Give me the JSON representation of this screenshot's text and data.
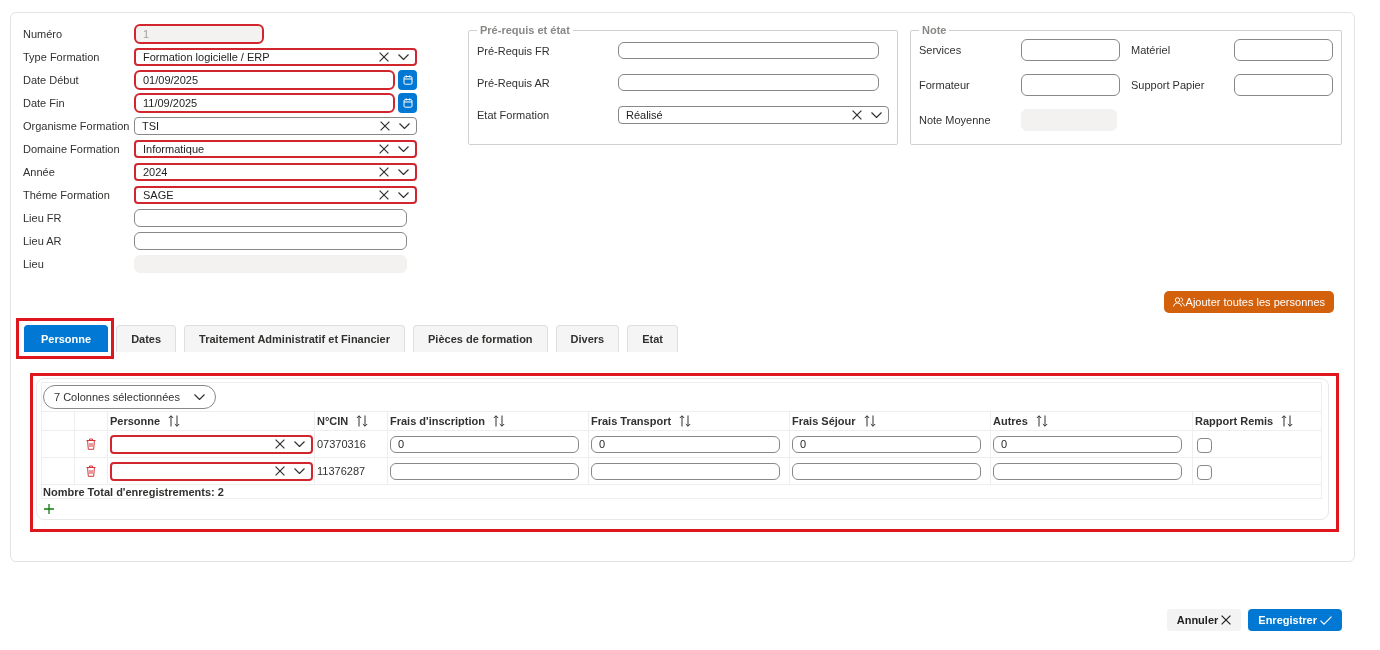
{
  "form": {
    "fields": [
      {
        "label": "Numéro",
        "kind": "number",
        "value": "1",
        "invalid": true,
        "disabled": true
      },
      {
        "label": "Type Formation",
        "kind": "select",
        "value": "Formation logicielle / ERP",
        "invalid": true,
        "disabled": false
      },
      {
        "label": "Date Début",
        "kind": "date",
        "value": "01/09/2025",
        "invalid": true,
        "disabled": false
      },
      {
        "label": "Date Fin",
        "kind": "date",
        "value": "11/09/2025",
        "invalid": true,
        "disabled": false
      },
      {
        "label": "Organisme Formation",
        "kind": "select",
        "value": "TSI",
        "invalid": false,
        "disabled": false
      },
      {
        "label": "Domaine Formation",
        "kind": "select",
        "value": "Informatique",
        "invalid": true,
        "disabled": false
      },
      {
        "label": "Année",
        "kind": "select",
        "value": "2024",
        "invalid": true,
        "disabled": false
      },
      {
        "label": "Théme Formation",
        "kind": "select",
        "value": "SAGE",
        "invalid": true,
        "disabled": false
      },
      {
        "label": "Lieu FR",
        "kind": "text",
        "invalid": false,
        "disabled": false
      },
      {
        "label": "Lieu AR",
        "kind": "text",
        "invalid": false,
        "disabled": false
      },
      {
        "label": "Lieu",
        "kind": "text",
        "invalid": false,
        "disabled": true
      }
    ]
  },
  "prerequisites": {
    "legend": "Pré-requis et état",
    "fields": [
      {
        "label": "Pré-Requis FR",
        "kind": "text"
      },
      {
        "label": "Pré-Requis AR",
        "kind": "text"
      },
      {
        "label": "Etat Formation",
        "kind": "select",
        "value": "Réalisé"
      }
    ]
  },
  "note": {
    "legend": "Note",
    "fields": [
      {
        "label": "Services",
        "disabled": false
      },
      {
        "label": "Matériel",
        "disabled": false
      },
      {
        "label": "Formateur",
        "disabled": false
      },
      {
        "label": "Support Papier",
        "disabled": false
      },
      {
        "label": "Note Moyenne",
        "disabled": true
      }
    ]
  },
  "add_all_button": {
    "label": "Ajouter toutes les personnes"
  },
  "tabs": [
    {
      "label": "Personne",
      "selected": true,
      "highlighted": true
    },
    {
      "label": "Dates",
      "selected": false,
      "highlighted": false
    },
    {
      "label": "Traitement Administratif et Financier",
      "selected": false,
      "highlighted": false
    },
    {
      "label": "Pièces de formation",
      "selected": false,
      "highlighted": false
    },
    {
      "label": "Divers",
      "selected": false,
      "highlighted": false
    },
    {
      "label": "Etat",
      "selected": false,
      "highlighted": false
    }
  ],
  "persons_table": {
    "highlighted": true,
    "column_picker": "7 Colonnes sélectionnées",
    "columns": [
      "Personne",
      "N°CIN",
      "Frais d'inscription",
      "Frais Transport",
      "Frais Séjour",
      "Autres",
      "Rapport Remis"
    ],
    "rows": [
      {
        "person_invalid": true,
        "cin": "07370316",
        "amounts": [
          "0",
          "0",
          "0",
          "0"
        ],
        "report_submitted": false
      },
      {
        "person_invalid": true,
        "cin": "11376287",
        "report_submitted": false
      }
    ],
    "record_count": "Nombre Total d'enregistrements: 2"
  },
  "actions": [
    {
      "label": "Annuler",
      "kind": "cancel"
    },
    {
      "label": "Enregistrer",
      "kind": "save"
    }
  ]
}
